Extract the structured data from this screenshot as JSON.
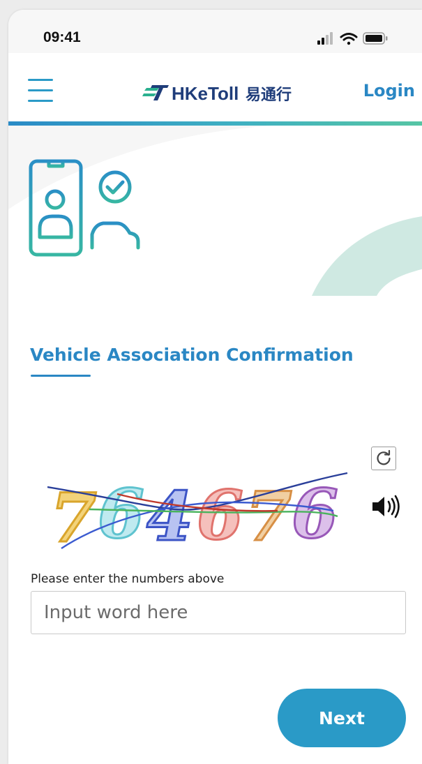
{
  "status_bar": {
    "time": "09:41"
  },
  "header": {
    "brand_en": "HKeToll",
    "brand_zh": "易通行",
    "login_label": "Login"
  },
  "main": {
    "title": "Vehicle Association Confirmation",
    "captcha": {
      "digits": [
        "7",
        "6",
        "4",
        "6",
        "7",
        "6"
      ],
      "digit_colors": [
        "#e6b73c",
        "#7fd3dc",
        "#5a6fd1",
        "#ea8884",
        "#e2a35d",
        "#a56ec0"
      ]
    },
    "instruction": "Please enter the numbers above",
    "input": {
      "placeholder": "Input word here",
      "value": ""
    },
    "next_label": "Next"
  },
  "icons": {
    "menu": "hamburger-icon",
    "hero": "phone-user-car-check-icon",
    "refresh": "refresh-icon",
    "audio": "speaker-icon",
    "signal": "signal-icon",
    "wifi": "wifi-icon",
    "battery": "battery-icon"
  },
  "colors": {
    "primary": "#2a87c4",
    "button": "#2a9ac7",
    "accent_green": "#56c5a4",
    "teal": "#3fb0c2"
  }
}
